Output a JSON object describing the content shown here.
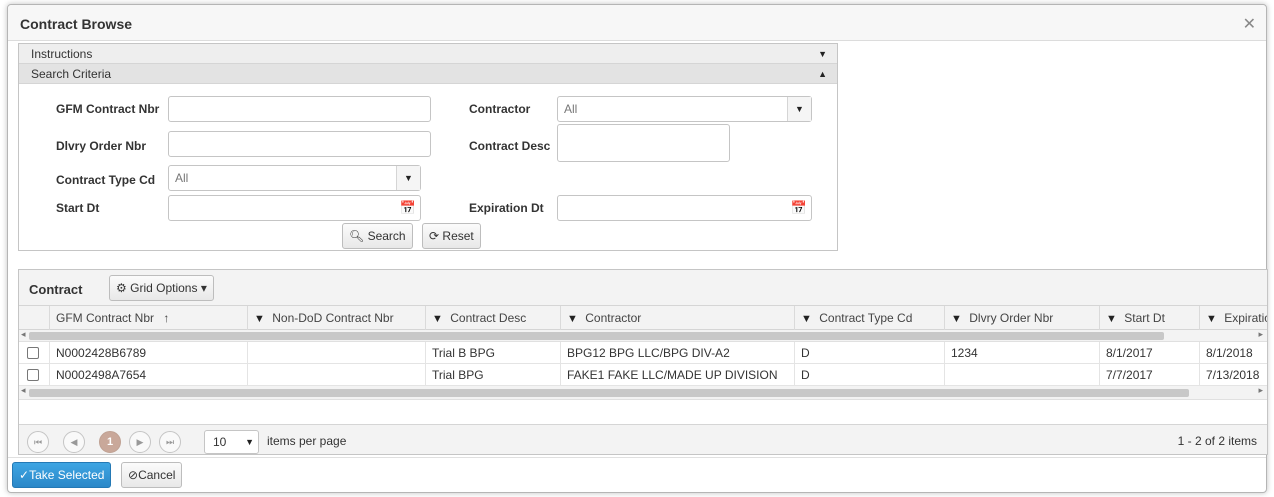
{
  "window": {
    "title": "Contract Browse"
  },
  "panels": {
    "instructions": "Instructions",
    "search_criteria": "Search Criteria"
  },
  "form": {
    "gfm_contract_nbr_label": "GFM Contract Nbr",
    "dlvry_order_nbr_label": "Dlvry Order Nbr",
    "contract_type_cd_label": "Contract Type Cd",
    "contract_type_cd_value": "All",
    "start_dt_label": "Start Dt",
    "contractor_label": "Contractor",
    "contractor_value": "All",
    "contract_desc_label": "Contract Desc",
    "expiration_dt_label": "Expiration Dt",
    "search_button": "Search",
    "reset_button": "Reset"
  },
  "grid": {
    "title": "Contract",
    "grid_options": "Grid Options",
    "columns": [
      "GFM Contract Nbr",
      "Non-DoD Contract Nbr",
      "Contract Desc",
      "Contractor",
      "Contract Type Cd",
      "Dlvry Order Nbr",
      "Start Dt",
      "Expiration"
    ],
    "sort_indicator": "↑",
    "rows": [
      [
        "N0002428B6789",
        "",
        "Trial B BPG",
        "BPG12 BPG LLC/BPG DIV-A2",
        "D",
        "1234",
        "8/1/2017",
        "8/1/2018"
      ],
      [
        "N0002498A7654",
        "",
        "Trial BPG",
        "FAKE1 FAKE LLC/MADE UP DIVISION",
        "D",
        "",
        "7/7/2017",
        "7/13/2018"
      ]
    ],
    "pager": {
      "current_page": "1",
      "page_size": "10",
      "items_per_page": "items per page",
      "info": "1 - 2 of 2 items"
    }
  },
  "footer": {
    "take_selected": "Take Selected",
    "cancel": "Cancel"
  },
  "colors": {
    "primary": "#2b88c8",
    "page_current": "#c9a89a"
  }
}
